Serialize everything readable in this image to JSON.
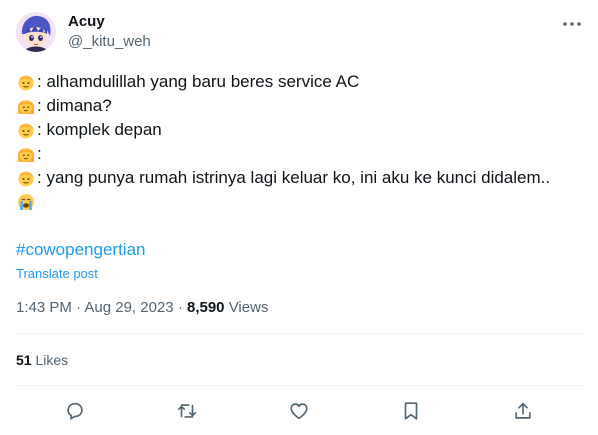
{
  "author": {
    "display_name": "Acuy",
    "handle": "@_kitu_weh",
    "avatar_icon": "anime-avatar-icon"
  },
  "tweet": {
    "lines": [
      {
        "emoji": "man-face-emoji",
        "text": ": alhamdulillah yang baru beres service AC"
      },
      {
        "emoji": "woman-face-emoji",
        "text": ": dimana?"
      },
      {
        "emoji": "man-face-emoji",
        "text": ": komplek depan"
      },
      {
        "emoji": "woman-face-emoji",
        "text": ":"
      },
      {
        "emoji": "man-face-emoji",
        "text": ": yang punya rumah istrinya lagi keluar ko, ini aku ke kunci didalem.."
      }
    ],
    "trailing_emoji": "loudly-crying-face-emoji",
    "hashtag": "#cowopengertian",
    "translate_label": "Translate post"
  },
  "meta": {
    "time": "1:43 PM",
    "separator": "·",
    "date": "Aug 29, 2023",
    "views_count": "8,590",
    "views_label": "Views"
  },
  "stats": {
    "likes_count": "51",
    "likes_label": "Likes"
  },
  "colors": {
    "link": "#1d9bf0",
    "muted": "#536471",
    "text": "#0f1419",
    "divider": "#eff3f4"
  },
  "actions": [
    "reply-icon",
    "retweet-icon",
    "like-icon",
    "bookmark-icon",
    "share-icon"
  ]
}
